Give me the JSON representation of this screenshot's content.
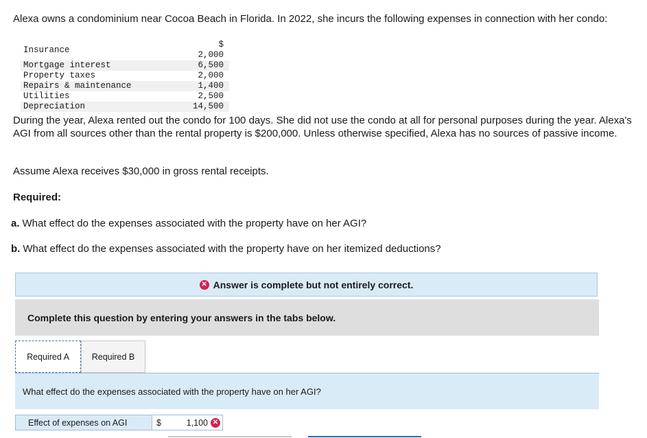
{
  "intro": "Alexa owns a condominium near Cocoa Beach in Florida. In 2022, she incurs the following expenses in connection with her condo:",
  "expenses": [
    {
      "label": "Insurance",
      "amount": "$ 2,000"
    },
    {
      "label": "Mortgage interest",
      "amount": "6,500"
    },
    {
      "label": "Property taxes",
      "amount": "2,000"
    },
    {
      "label": "Repairs & maintenance",
      "amount": "1,400"
    },
    {
      "label": "Utilities",
      "amount": "2,500"
    },
    {
      "label": "Depreciation",
      "amount": "14,500"
    }
  ],
  "paragraph1": "During the year, Alexa rented out the condo for 100 days. She did not use the condo at all for personal purposes during the year. Alexa's AGI from all sources other than the rental property is $200,000. Unless otherwise specified, Alexa has no sources of passive income.",
  "paragraph2": "Assume Alexa receives $30,000 in gross rental receipts.",
  "required_title": "Required:",
  "question_a": {
    "letter": "a.",
    "text": "What effect do the expenses associated with the property have on her AGI?"
  },
  "question_b": {
    "letter": "b.",
    "text": "What effect do the expenses associated with the property have on her itemized deductions?"
  },
  "status": "Answer is complete but not entirely correct.",
  "instruction": "Complete this question by entering your answers in the tabs below.",
  "tabs": [
    "Required A",
    "Required B"
  ],
  "tab_question": "What effect do the expenses associated with the property have on her AGI?",
  "answer": {
    "label": "Effect of expenses on AGI",
    "currency": "$",
    "value": "1,100"
  },
  "colors": {
    "incorrect": "#d9204b",
    "panel": "#d9ebf7",
    "accent": "#1f6fb5"
  }
}
